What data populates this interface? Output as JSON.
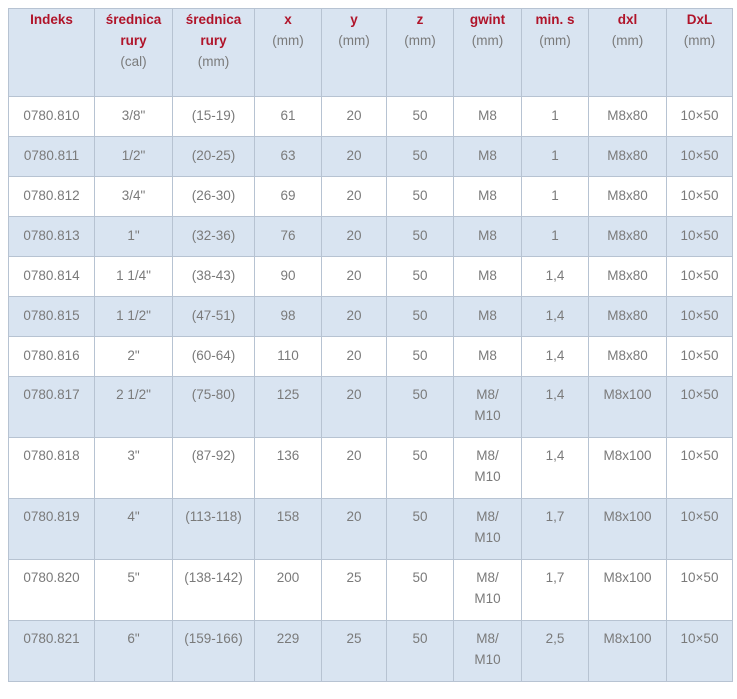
{
  "headers": [
    {
      "title": "Indeks",
      "title2": "",
      "unit": ""
    },
    {
      "title": "średnica",
      "title2": "rury",
      "unit": "(cal)"
    },
    {
      "title": "średnica",
      "title2": "rury",
      "unit": "(mm)"
    },
    {
      "title": "x",
      "title2": "",
      "unit": "(mm)"
    },
    {
      "title": "y",
      "title2": "",
      "unit": "(mm)"
    },
    {
      "title": "z",
      "title2": "",
      "unit": "(mm)"
    },
    {
      "title": "gwint",
      "title2": "",
      "unit": "(mm)"
    },
    {
      "title": "min. s",
      "title2": "",
      "unit": "(mm)"
    },
    {
      "title": "dxl",
      "title2": "",
      "unit": "(mm)"
    },
    {
      "title": "DxL",
      "title2": "",
      "unit": "(mm)"
    }
  ],
  "rows": [
    {
      "indeks": "0780.810",
      "cal": "3/8\"",
      "mm": "(15-19)",
      "x": "61",
      "y": "20",
      "z": "50",
      "gwint": "M8",
      "gwint2": "",
      "s": "1",
      "dxl": "M8x80",
      "DxL": "10×50"
    },
    {
      "indeks": "0780.811",
      "cal": "1/2\"",
      "mm": "(20-25)",
      "x": "63",
      "y": "20",
      "z": "50",
      "gwint": "M8",
      "gwint2": "",
      "s": "1",
      "dxl": "M8x80",
      "DxL": "10×50"
    },
    {
      "indeks": "0780.812",
      "cal": "3/4\"",
      "mm": "(26-30)",
      "x": "69",
      "y": "20",
      "z": "50",
      "gwint": "M8",
      "gwint2": "",
      "s": "1",
      "dxl": "M8x80",
      "DxL": "10×50"
    },
    {
      "indeks": "0780.813",
      "cal": "1\"",
      "mm": "(32-36)",
      "x": "76",
      "y": "20",
      "z": "50",
      "gwint": "M8",
      "gwint2": "",
      "s": "1",
      "dxl": "M8x80",
      "DxL": "10×50"
    },
    {
      "indeks": "0780.814",
      "cal": "1 1/4\"",
      "mm": "(38-43)",
      "x": "90",
      "y": "20",
      "z": "50",
      "gwint": "M8",
      "gwint2": "",
      "s": "1,4",
      "dxl": "M8x80",
      "DxL": "10×50"
    },
    {
      "indeks": "0780.815",
      "cal": "1 1/2\"",
      "mm": "(47-51)",
      "x": "98",
      "y": "20",
      "z": "50",
      "gwint": "M8",
      "gwint2": "",
      "s": "1,4",
      "dxl": "M8x80",
      "DxL": "10×50"
    },
    {
      "indeks": "0780.816",
      "cal": "2\"",
      "mm": "(60-64)",
      "x": "110",
      "y": "20",
      "z": "50",
      "gwint": "M8",
      "gwint2": "",
      "s": "1,4",
      "dxl": "M8x80",
      "DxL": "10×50"
    },
    {
      "indeks": "0780.817",
      "cal": "2 1/2\"",
      "mm": "(75-80)",
      "x": "125",
      "y": "20",
      "z": "50",
      "gwint": "M8/",
      "gwint2": "M10",
      "s": "1,4",
      "dxl": "M8x100",
      "DxL": "10×50"
    },
    {
      "indeks": "0780.818",
      "cal": "3\"",
      "mm": "(87-92)",
      "x": "136",
      "y": "20",
      "z": "50",
      "gwint": "M8/",
      "gwint2": "M10",
      "s": "1,4",
      "dxl": "M8x100",
      "DxL": "10×50"
    },
    {
      "indeks": "0780.819",
      "cal": "4\"",
      "mm": "(113-118)",
      "x": "158",
      "y": "20",
      "z": "50",
      "gwint": "M8/",
      "gwint2": "M10",
      "s": "1,7",
      "dxl": "M8x100",
      "DxL": "10×50"
    },
    {
      "indeks": "0780.820",
      "cal": "5\"",
      "mm": "(138-142)",
      "x": "200",
      "y": "25",
      "z": "50",
      "gwint": "M8/",
      "gwint2": "M10",
      "s": "1,7",
      "dxl": "M8x100",
      "DxL": "10×50"
    },
    {
      "indeks": "0780.821",
      "cal": "6\"",
      "mm": "(159-166)",
      "x": "229",
      "y": "25",
      "z": "50",
      "gwint": "M8/",
      "gwint2": "M10",
      "s": "2,5",
      "dxl": "M8x100",
      "DxL": "10×50"
    }
  ],
  "colors": {
    "header_bg": "#d9e4f1",
    "title_red": "#b0142a",
    "text_gray": "#7a7a7a",
    "border": "#b7c3d2"
  }
}
